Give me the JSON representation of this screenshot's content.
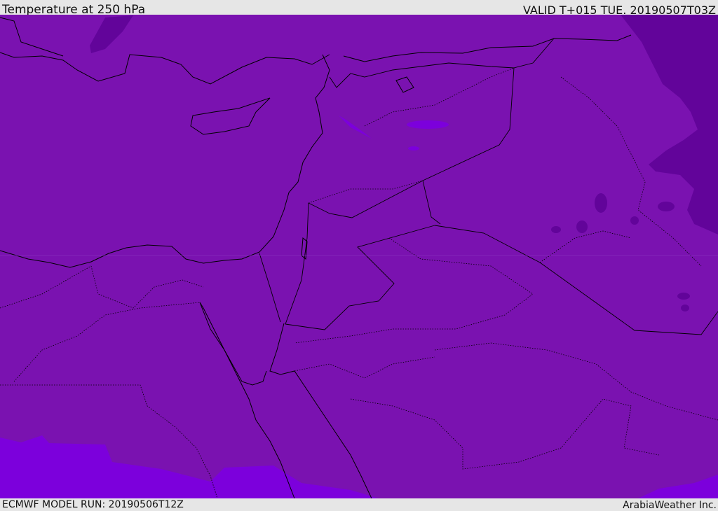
{
  "header": {
    "title": "Temperature at 250 hPa",
    "valid": "VALID T+015 TUE. 20190507T03Z"
  },
  "footer": {
    "model_run": "ECMWF MODEL RUN: 20190506T12Z",
    "credit": "ArabiaWeather Inc."
  },
  "colors": {
    "base_fill": "#7a12b0",
    "cold_fill": "#62049a",
    "warm_fill": "#7c00dc",
    "boundary": "#000000"
  }
}
